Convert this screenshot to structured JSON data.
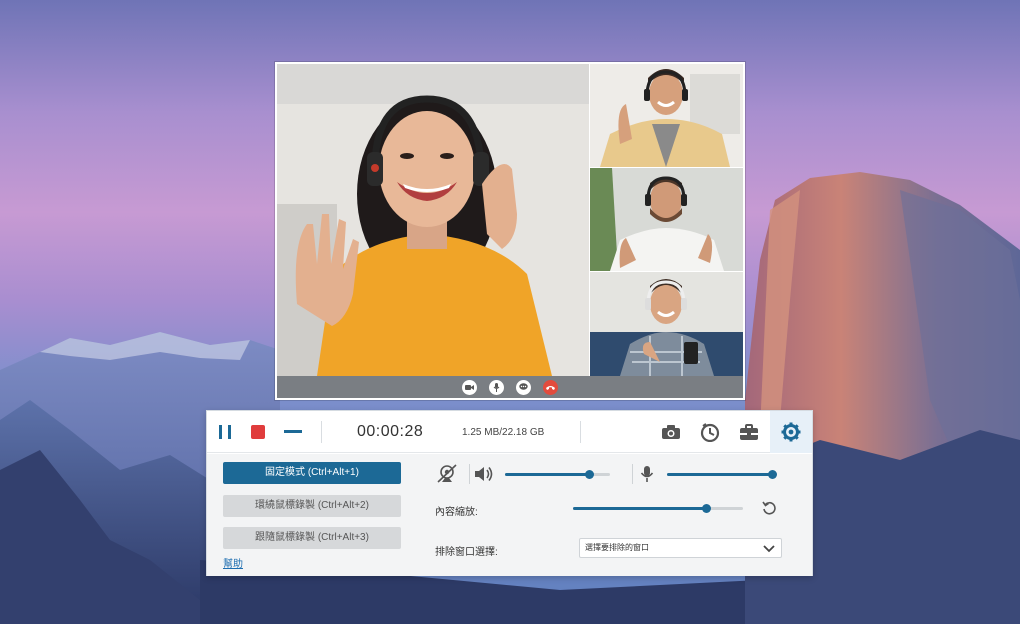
{
  "call": {
    "controls": [
      "camera-icon",
      "microphone-icon",
      "chat-icon",
      "hangup-icon"
    ]
  },
  "recorder": {
    "timer": "00:00:28",
    "file_size": "1.25 MB/22.18 GB",
    "modes": {
      "fixed": "固定模式 (Ctrl+Alt+1)",
      "around_mouse": "環繞鼠標錄製 (Ctrl+Alt+2)",
      "follow_mouse": "跟隨鼠標錄製 (Ctrl+Alt+3)"
    },
    "help_label": "幫助",
    "zoom_label": "內容縮放:",
    "exclude_label": "排除窗口選擇:",
    "exclude_value": "選擇要排除的窗口",
    "speaker_volume": 0.8,
    "mic_volume": 1.0,
    "zoom_level": 0.78,
    "colors": {
      "accent": "#1c6996",
      "stop": "#e03c3c",
      "hangup": "#e24b3d"
    }
  }
}
